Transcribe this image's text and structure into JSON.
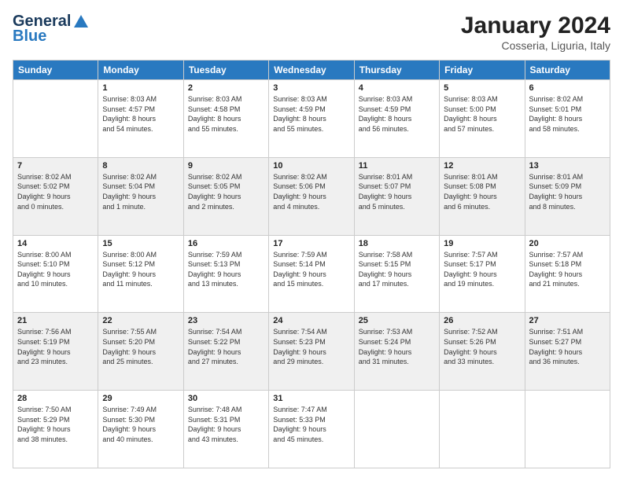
{
  "header": {
    "logo_line1": "General",
    "logo_line2": "Blue",
    "month": "January 2024",
    "location": "Cosseria, Liguria, Italy"
  },
  "days_of_week": [
    "Sunday",
    "Monday",
    "Tuesday",
    "Wednesday",
    "Thursday",
    "Friday",
    "Saturday"
  ],
  "weeks": [
    [
      {
        "day": "",
        "info": ""
      },
      {
        "day": "1",
        "info": "Sunrise: 8:03 AM\nSunset: 4:57 PM\nDaylight: 8 hours\nand 54 minutes."
      },
      {
        "day": "2",
        "info": "Sunrise: 8:03 AM\nSunset: 4:58 PM\nDaylight: 8 hours\nand 55 minutes."
      },
      {
        "day": "3",
        "info": "Sunrise: 8:03 AM\nSunset: 4:59 PM\nDaylight: 8 hours\nand 55 minutes."
      },
      {
        "day": "4",
        "info": "Sunrise: 8:03 AM\nSunset: 4:59 PM\nDaylight: 8 hours\nand 56 minutes."
      },
      {
        "day": "5",
        "info": "Sunrise: 8:03 AM\nSunset: 5:00 PM\nDaylight: 8 hours\nand 57 minutes."
      },
      {
        "day": "6",
        "info": "Sunrise: 8:02 AM\nSunset: 5:01 PM\nDaylight: 8 hours\nand 58 minutes."
      }
    ],
    [
      {
        "day": "7",
        "info": "Sunrise: 8:02 AM\nSunset: 5:02 PM\nDaylight: 9 hours\nand 0 minutes."
      },
      {
        "day": "8",
        "info": "Sunrise: 8:02 AM\nSunset: 5:04 PM\nDaylight: 9 hours\nand 1 minute."
      },
      {
        "day": "9",
        "info": "Sunrise: 8:02 AM\nSunset: 5:05 PM\nDaylight: 9 hours\nand 2 minutes."
      },
      {
        "day": "10",
        "info": "Sunrise: 8:02 AM\nSunset: 5:06 PM\nDaylight: 9 hours\nand 4 minutes."
      },
      {
        "day": "11",
        "info": "Sunrise: 8:01 AM\nSunset: 5:07 PM\nDaylight: 9 hours\nand 5 minutes."
      },
      {
        "day": "12",
        "info": "Sunrise: 8:01 AM\nSunset: 5:08 PM\nDaylight: 9 hours\nand 6 minutes."
      },
      {
        "day": "13",
        "info": "Sunrise: 8:01 AM\nSunset: 5:09 PM\nDaylight: 9 hours\nand 8 minutes."
      }
    ],
    [
      {
        "day": "14",
        "info": "Sunrise: 8:00 AM\nSunset: 5:10 PM\nDaylight: 9 hours\nand 10 minutes."
      },
      {
        "day": "15",
        "info": "Sunrise: 8:00 AM\nSunset: 5:12 PM\nDaylight: 9 hours\nand 11 minutes."
      },
      {
        "day": "16",
        "info": "Sunrise: 7:59 AM\nSunset: 5:13 PM\nDaylight: 9 hours\nand 13 minutes."
      },
      {
        "day": "17",
        "info": "Sunrise: 7:59 AM\nSunset: 5:14 PM\nDaylight: 9 hours\nand 15 minutes."
      },
      {
        "day": "18",
        "info": "Sunrise: 7:58 AM\nSunset: 5:15 PM\nDaylight: 9 hours\nand 17 minutes."
      },
      {
        "day": "19",
        "info": "Sunrise: 7:57 AM\nSunset: 5:17 PM\nDaylight: 9 hours\nand 19 minutes."
      },
      {
        "day": "20",
        "info": "Sunrise: 7:57 AM\nSunset: 5:18 PM\nDaylight: 9 hours\nand 21 minutes."
      }
    ],
    [
      {
        "day": "21",
        "info": "Sunrise: 7:56 AM\nSunset: 5:19 PM\nDaylight: 9 hours\nand 23 minutes."
      },
      {
        "day": "22",
        "info": "Sunrise: 7:55 AM\nSunset: 5:20 PM\nDaylight: 9 hours\nand 25 minutes."
      },
      {
        "day": "23",
        "info": "Sunrise: 7:54 AM\nSunset: 5:22 PM\nDaylight: 9 hours\nand 27 minutes."
      },
      {
        "day": "24",
        "info": "Sunrise: 7:54 AM\nSunset: 5:23 PM\nDaylight: 9 hours\nand 29 minutes."
      },
      {
        "day": "25",
        "info": "Sunrise: 7:53 AM\nSunset: 5:24 PM\nDaylight: 9 hours\nand 31 minutes."
      },
      {
        "day": "26",
        "info": "Sunrise: 7:52 AM\nSunset: 5:26 PM\nDaylight: 9 hours\nand 33 minutes."
      },
      {
        "day": "27",
        "info": "Sunrise: 7:51 AM\nSunset: 5:27 PM\nDaylight: 9 hours\nand 36 minutes."
      }
    ],
    [
      {
        "day": "28",
        "info": "Sunrise: 7:50 AM\nSunset: 5:29 PM\nDaylight: 9 hours\nand 38 minutes."
      },
      {
        "day": "29",
        "info": "Sunrise: 7:49 AM\nSunset: 5:30 PM\nDaylight: 9 hours\nand 40 minutes."
      },
      {
        "day": "30",
        "info": "Sunrise: 7:48 AM\nSunset: 5:31 PM\nDaylight: 9 hours\nand 43 minutes."
      },
      {
        "day": "31",
        "info": "Sunrise: 7:47 AM\nSunset: 5:33 PM\nDaylight: 9 hours\nand 45 minutes."
      },
      {
        "day": "",
        "info": ""
      },
      {
        "day": "",
        "info": ""
      },
      {
        "day": "",
        "info": ""
      }
    ]
  ]
}
